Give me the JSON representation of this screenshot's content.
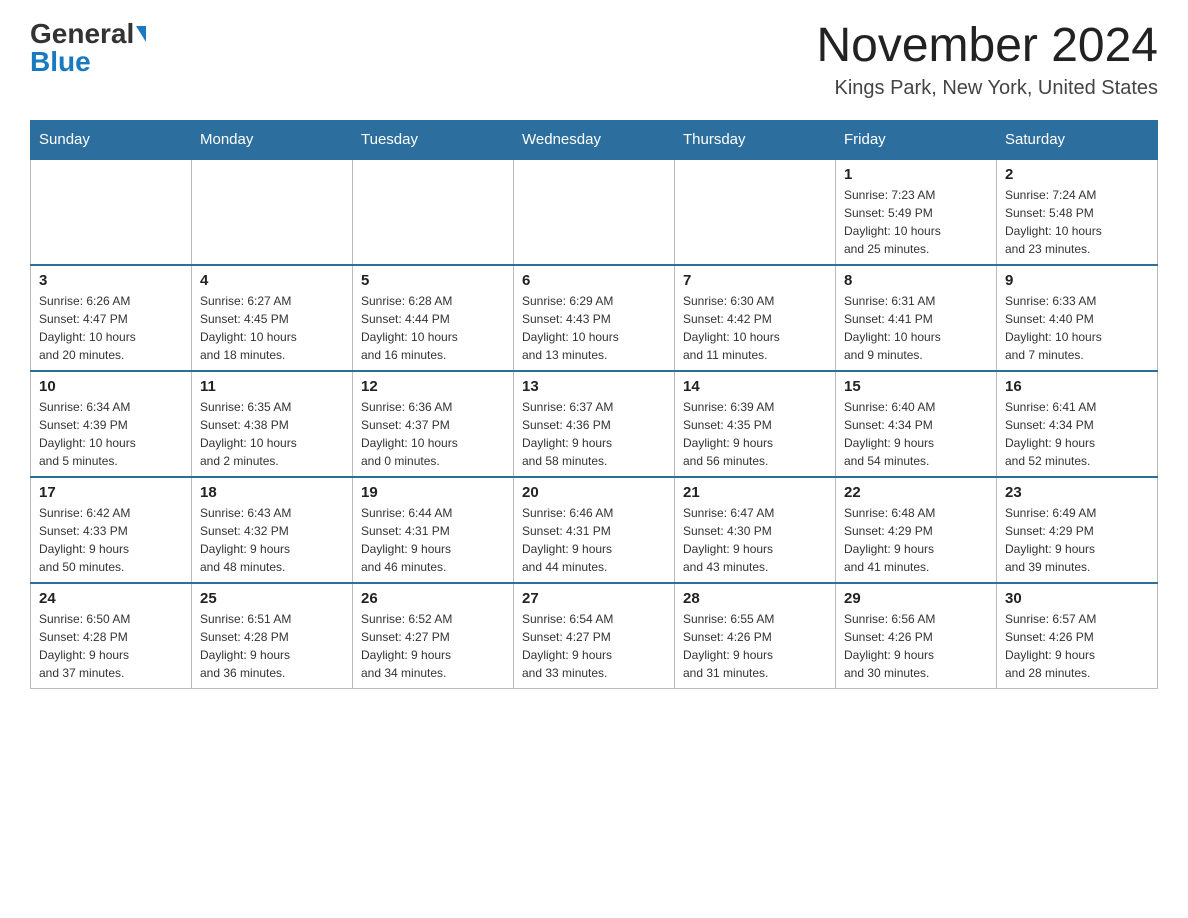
{
  "header": {
    "logo": {
      "general": "General",
      "blue": "Blue",
      "triangle": true
    },
    "title": "November 2024",
    "location": "Kings Park, New York, United States"
  },
  "weekdays": [
    "Sunday",
    "Monday",
    "Tuesday",
    "Wednesday",
    "Thursday",
    "Friday",
    "Saturday"
  ],
  "weeks": [
    {
      "days": [
        {
          "number": "",
          "info": ""
        },
        {
          "number": "",
          "info": ""
        },
        {
          "number": "",
          "info": ""
        },
        {
          "number": "",
          "info": ""
        },
        {
          "number": "",
          "info": ""
        },
        {
          "number": "1",
          "info": "Sunrise: 7:23 AM\nSunset: 5:49 PM\nDaylight: 10 hours\nand 25 minutes."
        },
        {
          "number": "2",
          "info": "Sunrise: 7:24 AM\nSunset: 5:48 PM\nDaylight: 10 hours\nand 23 minutes."
        }
      ]
    },
    {
      "days": [
        {
          "number": "3",
          "info": "Sunrise: 6:26 AM\nSunset: 4:47 PM\nDaylight: 10 hours\nand 20 minutes."
        },
        {
          "number": "4",
          "info": "Sunrise: 6:27 AM\nSunset: 4:45 PM\nDaylight: 10 hours\nand 18 minutes."
        },
        {
          "number": "5",
          "info": "Sunrise: 6:28 AM\nSunset: 4:44 PM\nDaylight: 10 hours\nand 16 minutes."
        },
        {
          "number": "6",
          "info": "Sunrise: 6:29 AM\nSunset: 4:43 PM\nDaylight: 10 hours\nand 13 minutes."
        },
        {
          "number": "7",
          "info": "Sunrise: 6:30 AM\nSunset: 4:42 PM\nDaylight: 10 hours\nand 11 minutes."
        },
        {
          "number": "8",
          "info": "Sunrise: 6:31 AM\nSunset: 4:41 PM\nDaylight: 10 hours\nand 9 minutes."
        },
        {
          "number": "9",
          "info": "Sunrise: 6:33 AM\nSunset: 4:40 PM\nDaylight: 10 hours\nand 7 minutes."
        }
      ]
    },
    {
      "days": [
        {
          "number": "10",
          "info": "Sunrise: 6:34 AM\nSunset: 4:39 PM\nDaylight: 10 hours\nand 5 minutes."
        },
        {
          "number": "11",
          "info": "Sunrise: 6:35 AM\nSunset: 4:38 PM\nDaylight: 10 hours\nand 2 minutes."
        },
        {
          "number": "12",
          "info": "Sunrise: 6:36 AM\nSunset: 4:37 PM\nDaylight: 10 hours\nand 0 minutes."
        },
        {
          "number": "13",
          "info": "Sunrise: 6:37 AM\nSunset: 4:36 PM\nDaylight: 9 hours\nand 58 minutes."
        },
        {
          "number": "14",
          "info": "Sunrise: 6:39 AM\nSunset: 4:35 PM\nDaylight: 9 hours\nand 56 minutes."
        },
        {
          "number": "15",
          "info": "Sunrise: 6:40 AM\nSunset: 4:34 PM\nDaylight: 9 hours\nand 54 minutes."
        },
        {
          "number": "16",
          "info": "Sunrise: 6:41 AM\nSunset: 4:34 PM\nDaylight: 9 hours\nand 52 minutes."
        }
      ]
    },
    {
      "days": [
        {
          "number": "17",
          "info": "Sunrise: 6:42 AM\nSunset: 4:33 PM\nDaylight: 9 hours\nand 50 minutes."
        },
        {
          "number": "18",
          "info": "Sunrise: 6:43 AM\nSunset: 4:32 PM\nDaylight: 9 hours\nand 48 minutes."
        },
        {
          "number": "19",
          "info": "Sunrise: 6:44 AM\nSunset: 4:31 PM\nDaylight: 9 hours\nand 46 minutes."
        },
        {
          "number": "20",
          "info": "Sunrise: 6:46 AM\nSunset: 4:31 PM\nDaylight: 9 hours\nand 44 minutes."
        },
        {
          "number": "21",
          "info": "Sunrise: 6:47 AM\nSunset: 4:30 PM\nDaylight: 9 hours\nand 43 minutes."
        },
        {
          "number": "22",
          "info": "Sunrise: 6:48 AM\nSunset: 4:29 PM\nDaylight: 9 hours\nand 41 minutes."
        },
        {
          "number": "23",
          "info": "Sunrise: 6:49 AM\nSunset: 4:29 PM\nDaylight: 9 hours\nand 39 minutes."
        }
      ]
    },
    {
      "days": [
        {
          "number": "24",
          "info": "Sunrise: 6:50 AM\nSunset: 4:28 PM\nDaylight: 9 hours\nand 37 minutes."
        },
        {
          "number": "25",
          "info": "Sunrise: 6:51 AM\nSunset: 4:28 PM\nDaylight: 9 hours\nand 36 minutes."
        },
        {
          "number": "26",
          "info": "Sunrise: 6:52 AM\nSunset: 4:27 PM\nDaylight: 9 hours\nand 34 minutes."
        },
        {
          "number": "27",
          "info": "Sunrise: 6:54 AM\nSunset: 4:27 PM\nDaylight: 9 hours\nand 33 minutes."
        },
        {
          "number": "28",
          "info": "Sunrise: 6:55 AM\nSunset: 4:26 PM\nDaylight: 9 hours\nand 31 minutes."
        },
        {
          "number": "29",
          "info": "Sunrise: 6:56 AM\nSunset: 4:26 PM\nDaylight: 9 hours\nand 30 minutes."
        },
        {
          "number": "30",
          "info": "Sunrise: 6:57 AM\nSunset: 4:26 PM\nDaylight: 9 hours\nand 28 minutes."
        }
      ]
    }
  ]
}
